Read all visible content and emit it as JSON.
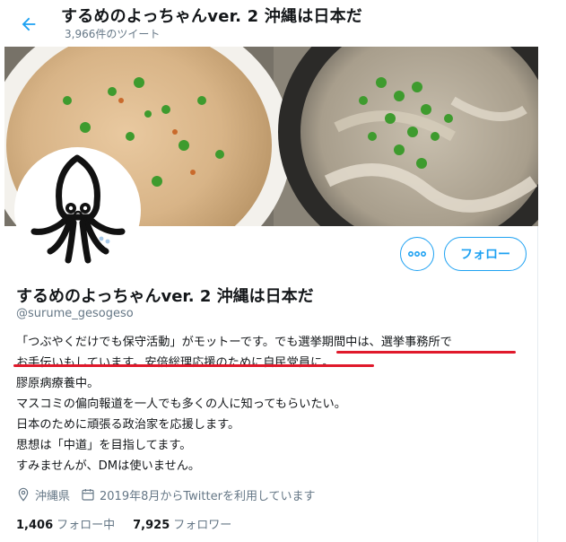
{
  "header": {
    "title": "するめのよっちゃんver. 2  沖縄は日本だ",
    "tweet_count": "3,966件のツイート",
    "back_icon": "arrow-left-icon"
  },
  "profile": {
    "name": "するめのよっちゃんver. 2  沖縄は日本だ",
    "handle": "@surume_gesogeso",
    "more_icon": "more-dots-icon",
    "follow_label": "フォロー",
    "bio_lines": [
      "「つぶやくだけでも保守活動」がモットーです。でも選挙期間中は、選挙事務所で",
      "お手伝いもしています。安倍総理応援のために自民党員に。",
      "膠原病療養中。",
      "マスコミの偏向報道を一人でも多くの人に知ってもらいたい。",
      "日本のために頑張る政治家を応援します。",
      "思想は「中道」を目指してます。",
      "すみませんが、DMは使いません。"
    ],
    "location": "沖縄県",
    "joined": "2019年8月からTwitterを利用しています",
    "following_count": "1,406",
    "following_label": "フォロー中",
    "followers_count": "7,925",
    "followers_label": "フォロワー"
  },
  "colors": {
    "accent": "#1da1f2",
    "annotation_underline": "#e0192b",
    "secondary_text": "#657786"
  }
}
